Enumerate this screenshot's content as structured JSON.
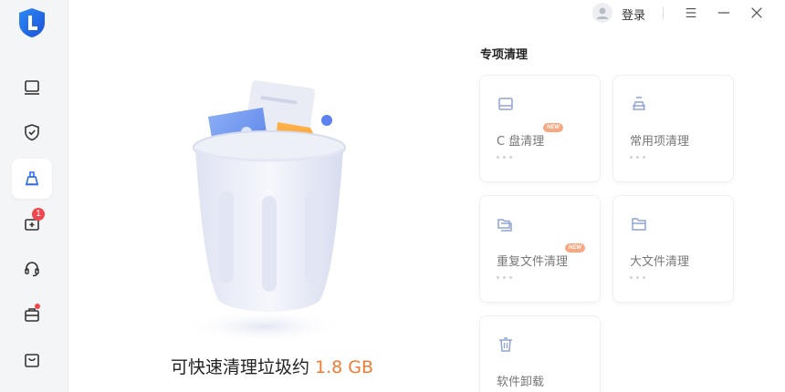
{
  "header": {
    "login_label": "登录"
  },
  "sidebar": {
    "items": [
      {
        "icon": "monitor-icon"
      },
      {
        "icon": "shield-check-icon"
      },
      {
        "icon": "broom-icon",
        "active": true
      },
      {
        "icon": "drive-plus-icon",
        "badge": "1"
      },
      {
        "icon": "headset-icon"
      },
      {
        "icon": "toolbox-icon",
        "dot": true
      },
      {
        "icon": "shopping-bag-icon"
      }
    ]
  },
  "main": {
    "summary_prefix": "可快速清理垃圾约",
    "summary_size": "1.8 GB"
  },
  "panel": {
    "title": "专项清理",
    "cards": [
      {
        "label": "C 盘清理",
        "badge": "NEW",
        "icon": "disk-icon"
      },
      {
        "label": "常用项清理",
        "icon": "brush-icon"
      },
      {
        "label": "重复文件清理",
        "badge": "NEW",
        "icon": "duplicate-folder-icon"
      },
      {
        "label": "大文件清理",
        "icon": "folder-icon"
      },
      {
        "label": "软件卸载",
        "icon": "trash-icon"
      }
    ]
  },
  "colors": {
    "accent": "#3b6df0",
    "highlight": "#f47a32",
    "icon_muted": "#9aa7c6"
  }
}
